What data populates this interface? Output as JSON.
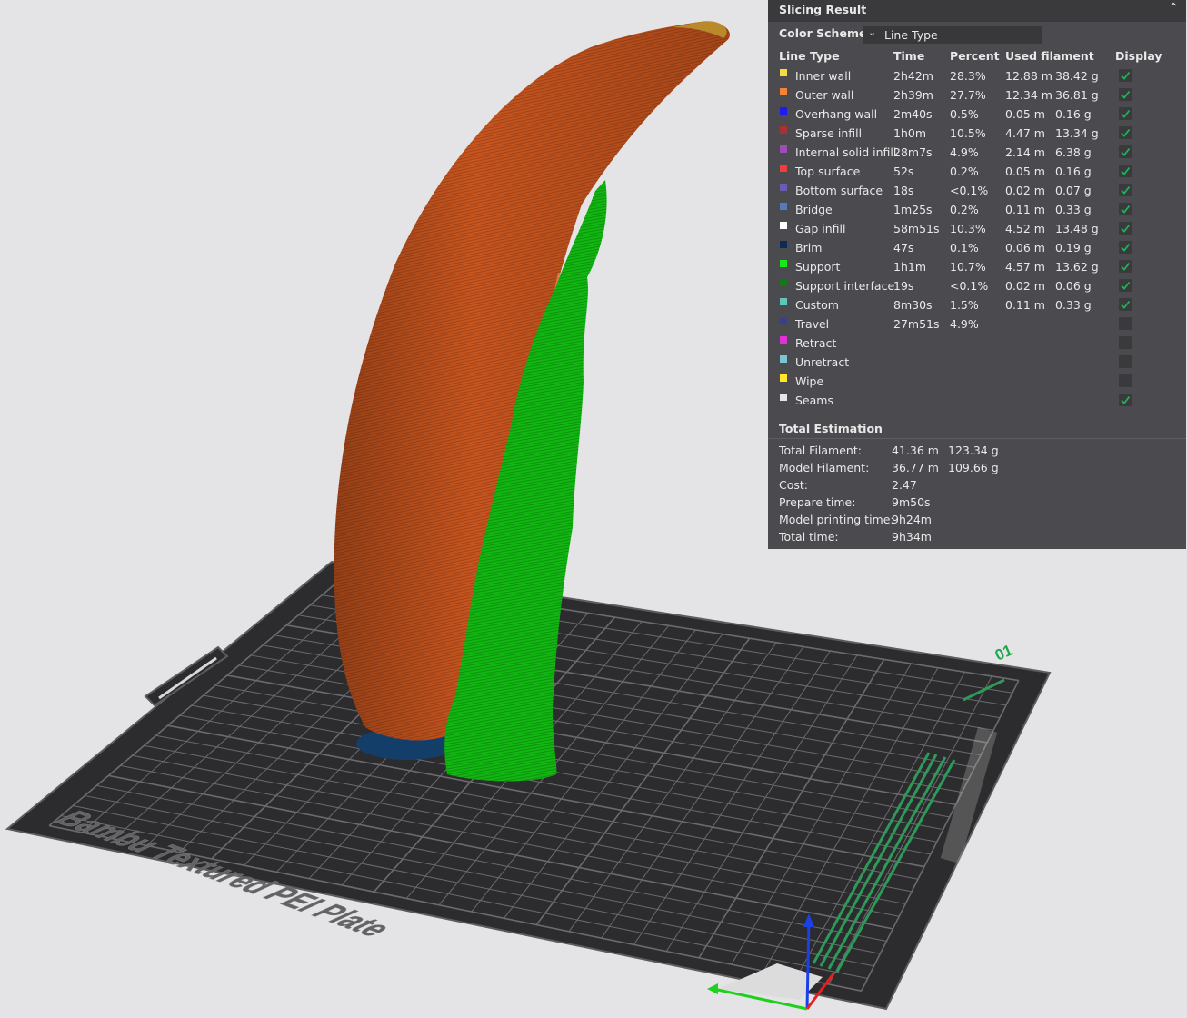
{
  "plate": {
    "label": "Bambu Textured PEI Plate",
    "number": "01"
  },
  "panel": {
    "title": "Slicing Result",
    "color_scheme_label": "Color Scheme",
    "color_scheme_value": "Line Type",
    "headers": {
      "type": "Line Type",
      "time": "Time",
      "percent": "Percent",
      "used": "Used filament",
      "display": "Display"
    },
    "rows": [
      {
        "name": "Inner wall",
        "color": "#f6dc3a",
        "time": "2h42m",
        "percent": "28.3%",
        "length": "12.88 m",
        "weight": "38.42 g",
        "display": true
      },
      {
        "name": "Outer wall",
        "color": "#f6823a",
        "time": "2h39m",
        "percent": "27.7%",
        "length": "12.34 m",
        "weight": "36.81 g",
        "display": true
      },
      {
        "name": "Overhang wall",
        "color": "#1c1cf0",
        "time": "2m40s",
        "percent": "0.5%",
        "length": "0.05 m",
        "weight": "0.16 g",
        "display": true
      },
      {
        "name": "Sparse infill",
        "color": "#a83232",
        "time": "1h0m",
        "percent": "10.5%",
        "length": "4.47 m",
        "weight": "13.34 g",
        "display": true
      },
      {
        "name": "Internal solid infill",
        "color": "#9a4fb8",
        "time": "28m7s",
        "percent": "4.9%",
        "length": "2.14 m",
        "weight": "6.38 g",
        "display": true
      },
      {
        "name": "Top surface",
        "color": "#f03c3c",
        "time": "52s",
        "percent": "0.2%",
        "length": "0.05 m",
        "weight": "0.16 g",
        "display": true
      },
      {
        "name": "Bottom surface",
        "color": "#6a5cb0",
        "time": "18s",
        "percent": "<0.1%",
        "length": "0.02 m",
        "weight": "0.07 g",
        "display": true
      },
      {
        "name": "Bridge",
        "color": "#4d80ba",
        "time": "1m25s",
        "percent": "0.2%",
        "length": "0.11 m",
        "weight": "0.33 g",
        "display": true
      },
      {
        "name": "Gap infill",
        "color": "#ffffff",
        "time": "58m51s",
        "percent": "10.3%",
        "length": "4.52 m",
        "weight": "13.48 g",
        "display": true
      },
      {
        "name": "Brim",
        "color": "#0d2a52",
        "time": "47s",
        "percent": "0.1%",
        "length": "0.06 m",
        "weight": "0.19 g",
        "display": true
      },
      {
        "name": "Support",
        "color": "#18e818",
        "time": "1h1m",
        "percent": "10.7%",
        "length": "4.57 m",
        "weight": "13.62 g",
        "display": true
      },
      {
        "name": "Support interface",
        "color": "#127a12",
        "time": "19s",
        "percent": "<0.1%",
        "length": "0.02 m",
        "weight": "0.06 g",
        "display": true
      },
      {
        "name": "Custom",
        "color": "#5ec8b4",
        "time": "8m30s",
        "percent": "1.5%",
        "length": "0.11 m",
        "weight": "0.33 g",
        "display": true
      },
      {
        "name": "Travel",
        "color": "#38408e",
        "time": "27m51s",
        "percent": "4.9%",
        "length": "",
        "weight": "",
        "display": false
      },
      {
        "name": "Retract",
        "color": "#e032d4",
        "time": "",
        "percent": "",
        "length": "",
        "weight": "",
        "display": false
      },
      {
        "name": "Unretract",
        "color": "#78c6d0",
        "time": "",
        "percent": "",
        "length": "",
        "weight": "",
        "display": false
      },
      {
        "name": "Wipe",
        "color": "#ffe628",
        "time": "",
        "percent": "",
        "length": "",
        "weight": "",
        "display": false
      },
      {
        "name": "Seams",
        "color": "#e6e6e6",
        "time": "",
        "percent": "",
        "length": "",
        "weight": "",
        "display": true
      }
    ],
    "total_title": "Total Estimation",
    "totals": [
      {
        "label": "Total Filament:",
        "v1": "41.36 m",
        "v2": "123.34 g"
      },
      {
        "label": "Model Filament:",
        "v1": "36.77 m",
        "v2": "109.66 g"
      },
      {
        "label": "Cost:",
        "v1": "2.47",
        "v2": ""
      },
      {
        "label": "Prepare time:",
        "v1": "9m50s",
        "v2": ""
      },
      {
        "label": "Model printing time:",
        "v1": "9h24m",
        "v2": ""
      },
      {
        "label": "Total time:",
        "v1": "9h34m",
        "v2": ""
      }
    ]
  }
}
